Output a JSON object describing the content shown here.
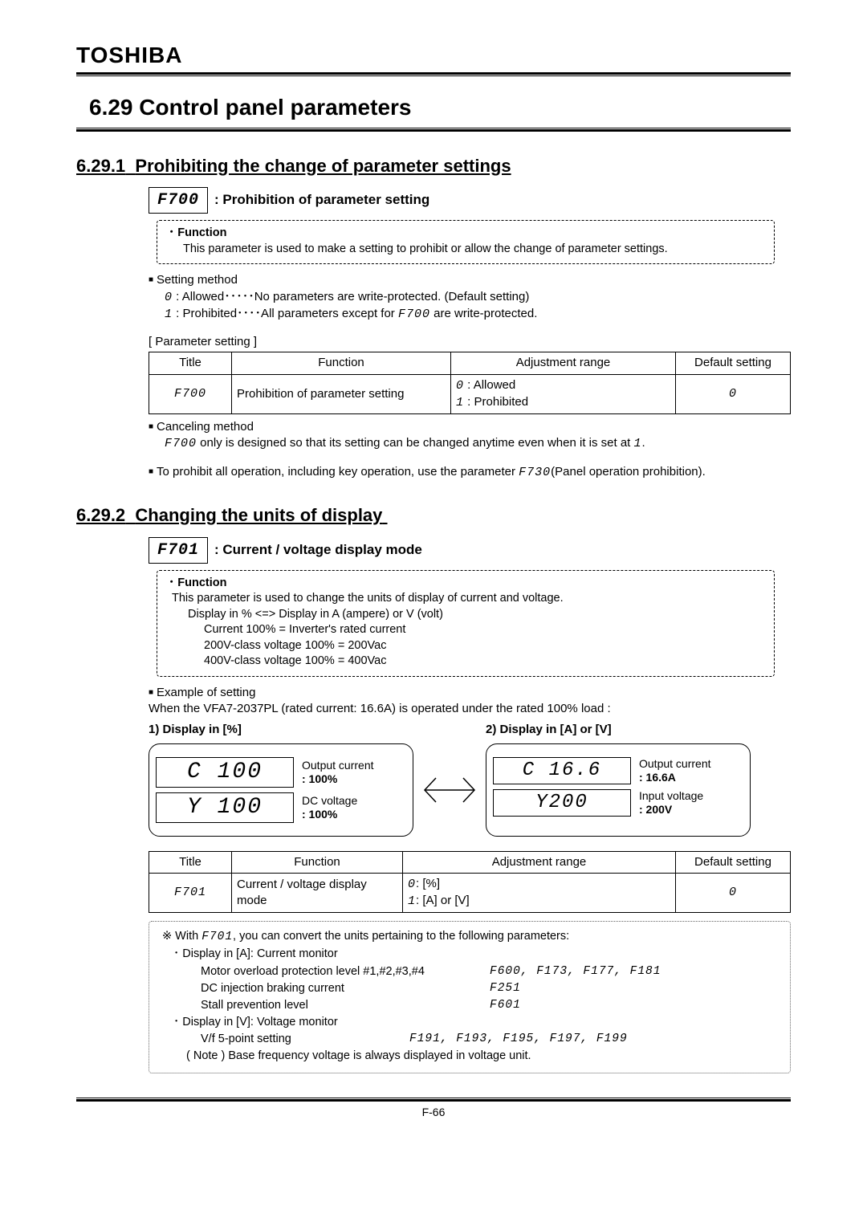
{
  "brand": "TOSHIBA",
  "section": {
    "num": "6.29",
    "title": "Control panel parameters"
  },
  "s1": {
    "num": "6.29.1",
    "title": "Prohibiting the change of parameter settings",
    "param_code": "F700",
    "param_title": ": Prohibition of parameter setting",
    "func_label": "･ Function",
    "func_text": "This parameter is used to make a setting to prohibit or allow the change of parameter settings.",
    "setting_method": "Setting method",
    "opt0_sym": "0",
    "opt0_text": " : Allowed･････No parameters are write-protected. (Default setting)",
    "opt1_sym": "1",
    "opt1_pre": " : Prohibited････All parameters except for ",
    "opt1_code": "F700",
    "opt1_post": " are write-protected.",
    "table_label": "[ Parameter setting ]",
    "th1": "Title",
    "th2": "Function",
    "th3": "Adjustment range",
    "th4": "Default setting",
    "row_title": "F700",
    "row_func": "Prohibition of parameter setting",
    "row_r0_sym": "0",
    "row_r0_txt": " : Allowed",
    "row_r1_sym": "1",
    "row_r1_txt": " : Prohibited",
    "row_def": "0",
    "cancel_head": "Canceling method",
    "cancel_code": "F700",
    "cancel_text": " only is designed so that its setting can be changed anytime even when it is set at ",
    "cancel_sym": "1",
    "cancel_period": ".",
    "prohibit_pre": "To prohibit all operation, including key operation, use the parameter ",
    "prohibit_code": "F730",
    "prohibit_post": "(Panel operation prohibition)."
  },
  "s2": {
    "num": "6.29.2",
    "title": "Changing the units of display",
    "param_code": "F701",
    "param_title": ": Current / voltage display mode",
    "func_label": "･ Function",
    "func_l1": "This parameter is used to change the units of display of current and voltage.",
    "func_l2": "Display in % <=> Display in A (ampere) or V (volt)",
    "func_l3": "Current 100% = Inverter's rated current",
    "func_l4": "200V-class voltage 100% = 200Vac",
    "func_l5": "400V-class voltage 100% = 400Vac",
    "ex_head": "Example of setting",
    "ex_text": "When the VFA7-2037PL (rated current: 16.6A) is operated under the rated 100% load :",
    "col1_head": "1) Display in [%]",
    "col2_head": "2) Display in [A] or [V]",
    "pct_cur_val": "C 100",
    "pct_cur_lbl1": "Output current",
    "pct_cur_lbl2": ": 100%",
    "pct_volt_val": "Y 100",
    "pct_volt_lbl1": "DC voltage",
    "pct_volt_lbl2": ": 100%",
    "av_cur_val": "C 16.6",
    "av_cur_lbl1": "Output current",
    "av_cur_lbl2": ": 16.6A",
    "av_volt_val": "Y200",
    "av_volt_lbl1": "Input voltage",
    "av_volt_lbl2": ": 200V",
    "th1": "Title",
    "th2": "Function",
    "th3": "Adjustment range",
    "th4": "Default setting",
    "row_title": "F701",
    "row_func": "Current / voltage display mode",
    "row_r0_sym": "0",
    "row_r0_txt": ": [%]",
    "row_r1_sym": "1",
    "row_r1_txt": ": [A] or [V]",
    "row_def": "0",
    "note_sym": "※",
    "note_pre": " With ",
    "note_code": "F701",
    "note_post": ", you can convert the units pertaining to the following parameters:",
    "note_a_head": "･ Display in [A]: Current monitor",
    "note_a1_l": "Motor overload protection level #1,#2,#3,#4",
    "note_a1_r": "F600, F173, F177, F181",
    "note_a2_l": "DC injection braking current",
    "note_a2_r": "F251",
    "note_a3_l": "Stall prevention level",
    "note_a3_r": "F601",
    "note_v_head": "･ Display in [V]: Voltage monitor",
    "note_v1_l": "V/f 5-point setting",
    "note_v1_r": "F191, F193, F195, F197, F199",
    "note_foot": "( Note ) Base frequency voltage is always displayed in voltage unit."
  },
  "page": "F-66"
}
